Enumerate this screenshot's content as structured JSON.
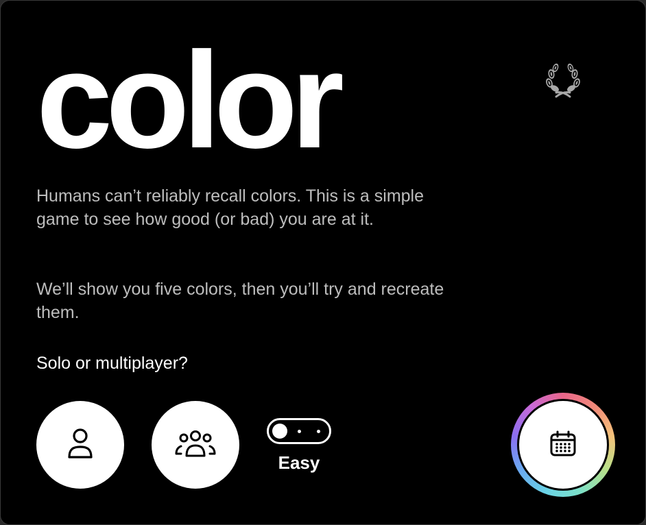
{
  "app": {
    "title": "color"
  },
  "intro": {
    "paragraph1": "Humans can’t reliably recall colors. This is a simple game to see how good (or bad) you are at it.",
    "paragraph2": "We’ll show you five colors, then you’ll try and recreate them."
  },
  "mode": {
    "prompt": "Solo or multiplayer?",
    "solo_icon": "person-icon",
    "multiplayer_icon": "group-icon"
  },
  "difficulty": {
    "label": "Easy",
    "levels": 3,
    "selected_index": 0
  },
  "icons": {
    "leaderboard": "laurel-wreath-icon",
    "daily": "calendar-icon"
  },
  "colors": {
    "background": "#000000",
    "foreground": "#ffffff",
    "body_text": "#bdbdbd",
    "icon_gray": "#a8a8a8"
  }
}
